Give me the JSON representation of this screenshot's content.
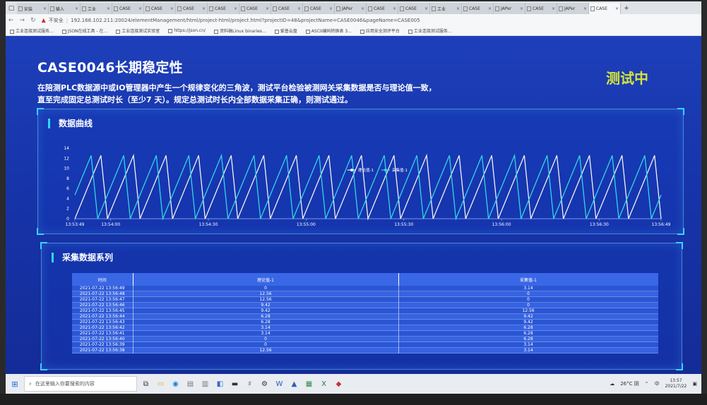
{
  "browser": {
    "tabs": [
      {
        "label": "安装"
      },
      {
        "label": "输入"
      },
      {
        "label": "工业"
      },
      {
        "label": "CASE"
      },
      {
        "label": "CASE"
      },
      {
        "label": "CASE"
      },
      {
        "label": "CASE"
      },
      {
        "label": "CASE"
      },
      {
        "label": "CASE"
      },
      {
        "label": "CASE"
      },
      {
        "label": "JAPer"
      },
      {
        "label": "CASE"
      },
      {
        "label": "CASE"
      },
      {
        "label": "工业"
      },
      {
        "label": "CASE"
      },
      {
        "label": "JAPer"
      },
      {
        "label": "CASE"
      },
      {
        "label": "JAPer"
      },
      {
        "label": "CASE"
      }
    ],
    "security_label": "不安全",
    "url": "192.168.102.211:20024/elementManagement/html/project-html/project.html?projectID=48&projectName=CASE0046&pageName=CASE005",
    "bookmarks": [
      {
        "label": "工业连接测试服务..."
      },
      {
        "label": "JSON在线工具 - 在..."
      },
      {
        "label": "工业连接测试实验室"
      },
      {
        "label": "https://json.cn/"
      },
      {
        "label": "资料稿Linux binaries..."
      },
      {
        "label": "爱普云盘"
      },
      {
        "label": "ASCII编码转换表 3..."
      },
      {
        "label": "应用安全测评平台"
      },
      {
        "label": "工业连接测试服务..."
      }
    ]
  },
  "page": {
    "title": "CASE0046长期稳定性",
    "description_line1": "在陪测PLC数据源中或IO管理器中产生一个规律变化的三角波，测试平台检验被测网关采集数据是否与理论值一致，",
    "description_line2": "直至完成固定总测试时长（至少7 天）。规定总测试时长内全部数据采集正确，则测试通过。",
    "status": "测试中"
  },
  "chart_panel": {
    "title": "数据曲线"
  },
  "table_panel": {
    "title": "采集数据系列"
  },
  "chart_data": {
    "type": "line",
    "title": "",
    "xlabel": "",
    "ylabel": "",
    "ylim": [
      0,
      14
    ],
    "yticks": [
      0,
      2,
      4,
      6,
      8,
      10,
      12,
      14
    ],
    "x_tick_labels": [
      "13:53:49",
      "13:54:00",
      "13:54:30",
      "13:55:00",
      "13:55:30",
      "13:56:00",
      "13:56:30",
      "13:56:49"
    ],
    "x_range_seconds": [
      0,
      180
    ],
    "x_tick_seconds": [
      0,
      11,
      41,
      71,
      101,
      131,
      161,
      180
    ],
    "wave": {
      "period_seconds": 10,
      "max": 12.56,
      "min": 0,
      "phase_shift_seconds": 3
    },
    "grid": false,
    "legend_position": "top-center",
    "series": [
      {
        "name": "理论值-1",
        "color": "#f2f2f2"
      },
      {
        "name": "采集值-1",
        "color": "#33d6e6"
      }
    ]
  },
  "table": {
    "headers": [
      "时间",
      "理论值-1",
      "采集值-1"
    ],
    "rows": [
      [
        "2021-07-22 13:56:49",
        "0",
        "3.14"
      ],
      [
        "2021-07-22 13:56:48",
        "12.56",
        "0"
      ],
      [
        "2021-07-22 13:56:47",
        "12.56",
        "0"
      ],
      [
        "2021-07-22 13:56:46",
        "9.42",
        "0"
      ],
      [
        "2021-07-22 13:56:45",
        "9.42",
        "12.56"
      ],
      [
        "2021-07-22 13:56:44",
        "6.28",
        "9.42"
      ],
      [
        "2021-07-22 13:56:43",
        "6.28",
        "9.42"
      ],
      [
        "2021-07-22 13:56:42",
        "3.14",
        "6.28"
      ],
      [
        "2021-07-22 13:56:41",
        "3.14",
        "6.28"
      ],
      [
        "2021-07-22 13:56:40",
        "0",
        "6.28"
      ],
      [
        "2021-07-22 13:56:39",
        "0",
        "3.14"
      ],
      [
        "2021-07-22 13:56:38",
        "12.56",
        "3.14"
      ]
    ]
  },
  "taskbar": {
    "search_placeholder": "在这里输入你要搜索的内容",
    "weather": "26°C 阴",
    "ime": "中",
    "time": "13:57",
    "date": "2021/7/22"
  }
}
